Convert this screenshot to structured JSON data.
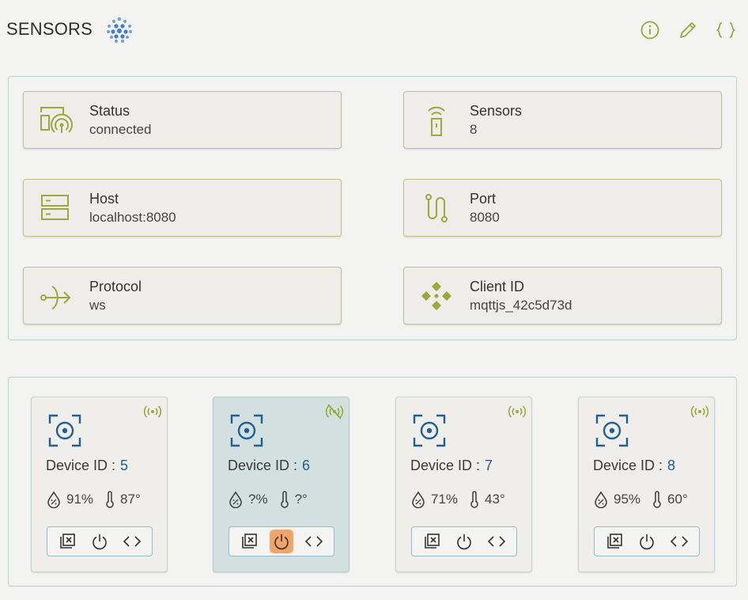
{
  "header": {
    "title": "SENSORS",
    "actions": [
      {
        "name": "info-button",
        "icon": "info-icon"
      },
      {
        "name": "edit-button",
        "icon": "pencil-icon"
      },
      {
        "name": "json-button",
        "icon": "braces-icon"
      }
    ]
  },
  "info": {
    "status": {
      "label": "Status",
      "value": "connected",
      "icon": "device-signal-icon"
    },
    "sensors": {
      "label": "Sensors",
      "value": "8",
      "icon": "remote-sensor-icon"
    },
    "host": {
      "label": "Host",
      "value": "localhost:8080",
      "icon": "server-icon"
    },
    "port": {
      "label": "Port",
      "value": "8080",
      "icon": "port-icon"
    },
    "protocol": {
      "label": "Protocol",
      "value": "ws",
      "icon": "protocol-icon"
    },
    "client": {
      "label": "Client ID",
      "value": "mqttjs_42c5d73d",
      "icon": "client-icon"
    }
  },
  "devices": [
    {
      "label": "Device ID :",
      "id": "5",
      "humidity": "91%",
      "temperature": "87°",
      "online": true,
      "power_on": false
    },
    {
      "label": "Device ID :",
      "id": "6",
      "humidity": "?%",
      "temperature": "?°",
      "online": false,
      "power_on": true
    },
    {
      "label": "Device ID :",
      "id": "7",
      "humidity": "71%",
      "temperature": "43°",
      "online": true,
      "power_on": false
    },
    {
      "label": "Device ID :",
      "id": "8",
      "humidity": "95%",
      "temperature": "60°",
      "online": true,
      "power_on": false
    }
  ],
  "colors": {
    "accent_green": "#9aa83c",
    "device_blue": "#1f5f94",
    "power_on_orange": "#f2a468",
    "offline_bg": "#d3e0e0"
  }
}
